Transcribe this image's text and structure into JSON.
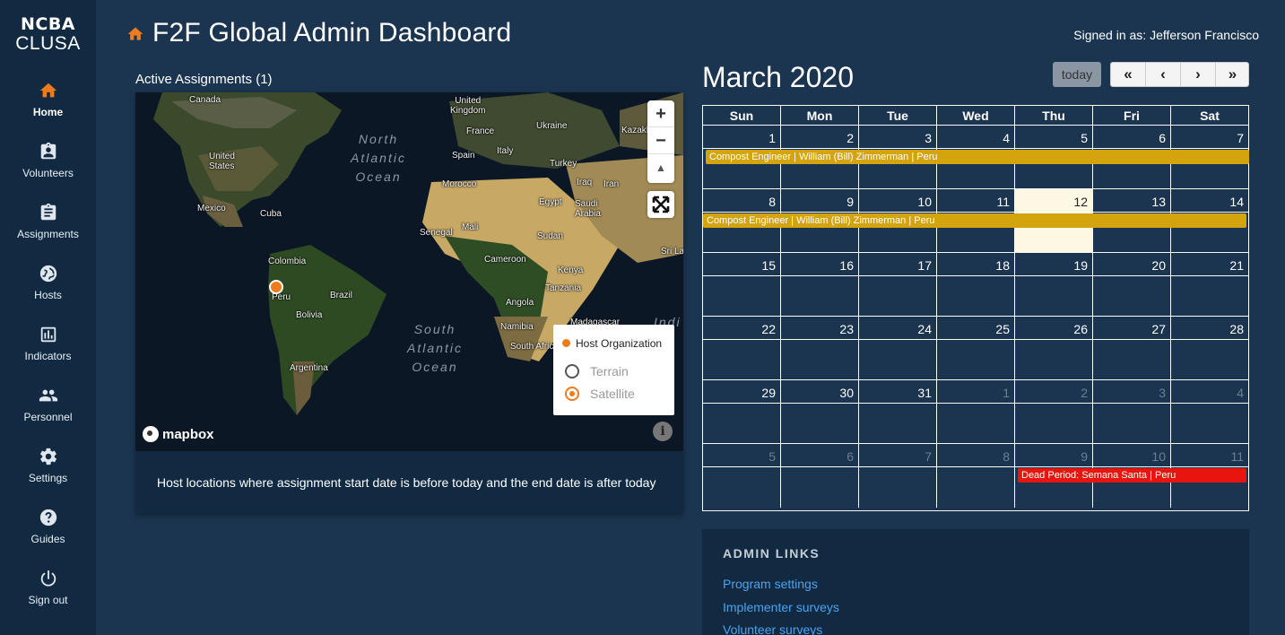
{
  "sidebar": {
    "logo_top": "NCBA",
    "logo_bottom": "CLUSA",
    "items": [
      {
        "label": "Home",
        "icon": "home-icon"
      },
      {
        "label": "Volunteers",
        "icon": "badge-icon"
      },
      {
        "label": "Assignments",
        "icon": "clipboard-icon"
      },
      {
        "label": "Hosts",
        "icon": "globe-icon"
      },
      {
        "label": "Indicators",
        "icon": "chart-icon"
      },
      {
        "label": "Personnel",
        "icon": "people-icon"
      },
      {
        "label": "Settings",
        "icon": "gear-icon"
      },
      {
        "label": "Guides",
        "icon": "help-icon"
      },
      {
        "label": "Sign out",
        "icon": "power-icon"
      }
    ]
  },
  "header": {
    "title": "F2F Global Admin Dashboard",
    "signed_in": "Signed in as: Jefferson Francisco"
  },
  "map": {
    "heading": "Active Assignments (1)",
    "labels": {
      "canada": "Canada",
      "united_states": "United\nStates",
      "mexico": "Mexico",
      "cuba": "Cuba",
      "colombia": "Colombia",
      "peru": "Peru",
      "brazil": "Brazil",
      "bolivia": "Bolivia",
      "argentina": "Argentina",
      "united_kingdom": "United\nKingdom",
      "france": "France",
      "spain": "Spain",
      "italy": "Italy",
      "ukraine": "Ukraine",
      "kazakh": "Kazakh",
      "turkey": "Turkey",
      "morocco": "Morocco",
      "iraq": "Iraq",
      "iran": "Iran",
      "egypt": "Egypt",
      "saudi_arabia": "Saudi\nArabia",
      "senegal": "Senegal",
      "mali": "Mali",
      "sudan": "Sudan",
      "cameroon": "Cameroon",
      "kenya": "Kenya",
      "tanzania": "Tanzania",
      "angola": "Angola",
      "namibia": "Namibia",
      "madagascar": "Madagascar",
      "south_africa": "South Africa",
      "sri_lanka": "Sri La",
      "india_ocean": "Indi",
      "north_atlantic": "North\nAtlantic\nOcean",
      "south_atlantic": "South\nAtlantic\nOcean"
    },
    "zoom_in": "+",
    "zoom_out": "−",
    "compass": "▲",
    "legend": {
      "host_label": "Host Organization",
      "options": [
        "Terrain",
        "Satellite"
      ],
      "selected": "Satellite"
    },
    "attribution": "mapbox",
    "info": "i",
    "caption": "Host locations where assignment start date is before today and the end date is after today",
    "colors": {
      "marker": "#f07b1a"
    }
  },
  "calendar": {
    "title": "March 2020",
    "today_label": "today",
    "nav": [
      "«",
      "‹",
      "›",
      "»"
    ],
    "day_names": [
      "Sun",
      "Mon",
      "Tue",
      "Wed",
      "Thu",
      "Fri",
      "Sat"
    ],
    "weeks": [
      [
        "1",
        "2",
        "3",
        "4",
        "5",
        "6",
        "7"
      ],
      [
        "8",
        "9",
        "10",
        "11",
        "12",
        "13",
        "14"
      ],
      [
        "15",
        "16",
        "17",
        "18",
        "19",
        "20",
        "21"
      ],
      [
        "22",
        "23",
        "24",
        "25",
        "26",
        "27",
        "28"
      ],
      [
        "29",
        "30",
        "31",
        "1",
        "2",
        "3",
        "4"
      ],
      [
        "5",
        "6",
        "7",
        "8",
        "9",
        "10",
        "11"
      ]
    ],
    "events": [
      {
        "title": "Compost Engineer | William (Bill) Zimmerman | Peru",
        "color": "#d4a40f"
      },
      {
        "title": "Compost Engineer | William (Bill) Zimmerman | Peru",
        "color": "#d4a40f"
      },
      {
        "title": "Dead Period: Semana Santa | Peru",
        "color": "#e8150f"
      }
    ],
    "colors": {
      "today_bg": "#fcf8e3"
    }
  },
  "admin": {
    "title": "ADMIN LINKS",
    "links": [
      "Program settings",
      "Implementer surveys",
      "Volunteer surveys"
    ]
  }
}
